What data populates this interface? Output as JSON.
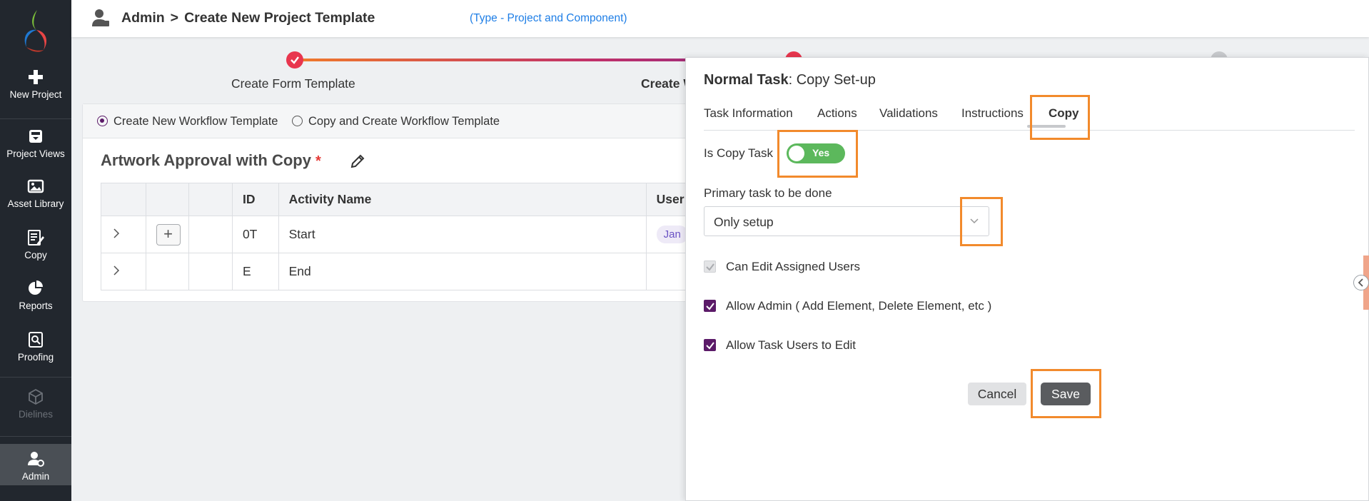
{
  "sidebar": {
    "items": [
      {
        "label": "New Project",
        "icon": "plus-icon"
      },
      {
        "label": "Project Views",
        "icon": "project-views-icon"
      },
      {
        "label": "Asset Library",
        "icon": "image-icon"
      },
      {
        "label": "Copy",
        "icon": "copy-edit-icon"
      },
      {
        "label": "Reports",
        "icon": "pie-chart-icon"
      },
      {
        "label": "Proofing",
        "icon": "proofing-icon"
      },
      {
        "label": "Dielines",
        "icon": "cube-icon"
      },
      {
        "label": "Admin",
        "icon": "admin-user-icon"
      }
    ]
  },
  "header": {
    "section": "Admin",
    "separator": ">",
    "page_title": "Create New Project Template",
    "type_note": "(Type - Project and Component)"
  },
  "stepper": {
    "steps": [
      {
        "label": "Create Form Template",
        "state": "done"
      },
      {
        "label": "Create W",
        "state": "current"
      }
    ]
  },
  "workflow": {
    "radio_new": "Create New Workflow Template",
    "radio_copy": "Copy and Create Workflow Template",
    "selected": "new",
    "title": "Artwork Approval with Copy",
    "required_mark": "*",
    "columns": [
      "",
      "",
      "",
      "ID",
      "Activity Name",
      "User"
    ],
    "column_user_visible": "User",
    "rows": [
      {
        "id": "0T",
        "name": "Start",
        "has_add": true,
        "user_chip": "Jan"
      },
      {
        "id": "E",
        "name": "End",
        "has_add": false,
        "user_chip": ""
      }
    ]
  },
  "panel": {
    "title_bold": "Normal Task",
    "title_rest": ": Copy Set-up",
    "tabs": [
      "Task Information",
      "Actions",
      "Validations",
      "Instructions",
      "Copy"
    ],
    "active_tab": "Copy",
    "is_copy_label": "Is Copy Task",
    "is_copy_value": "Yes",
    "primary_label": "Primary task to be done",
    "primary_value": "Only setup",
    "checkboxes": [
      {
        "label": "Can Edit Assigned Users",
        "checked": true,
        "disabled": true
      },
      {
        "label": "Allow Admin ( Add Element, Delete Element, etc )",
        "checked": true,
        "disabled": false
      },
      {
        "label": "Allow Task Users to Edit",
        "checked": true,
        "disabled": false
      }
    ],
    "cancel_label": "Cancel",
    "save_label": "Save"
  },
  "colors": {
    "sidebar_bg": "#22272e",
    "accent_purple": "#5b1a68",
    "highlight_orange": "#f28a2c",
    "toggle_green": "#5cb85c",
    "link_blue": "#1e7ee6"
  }
}
